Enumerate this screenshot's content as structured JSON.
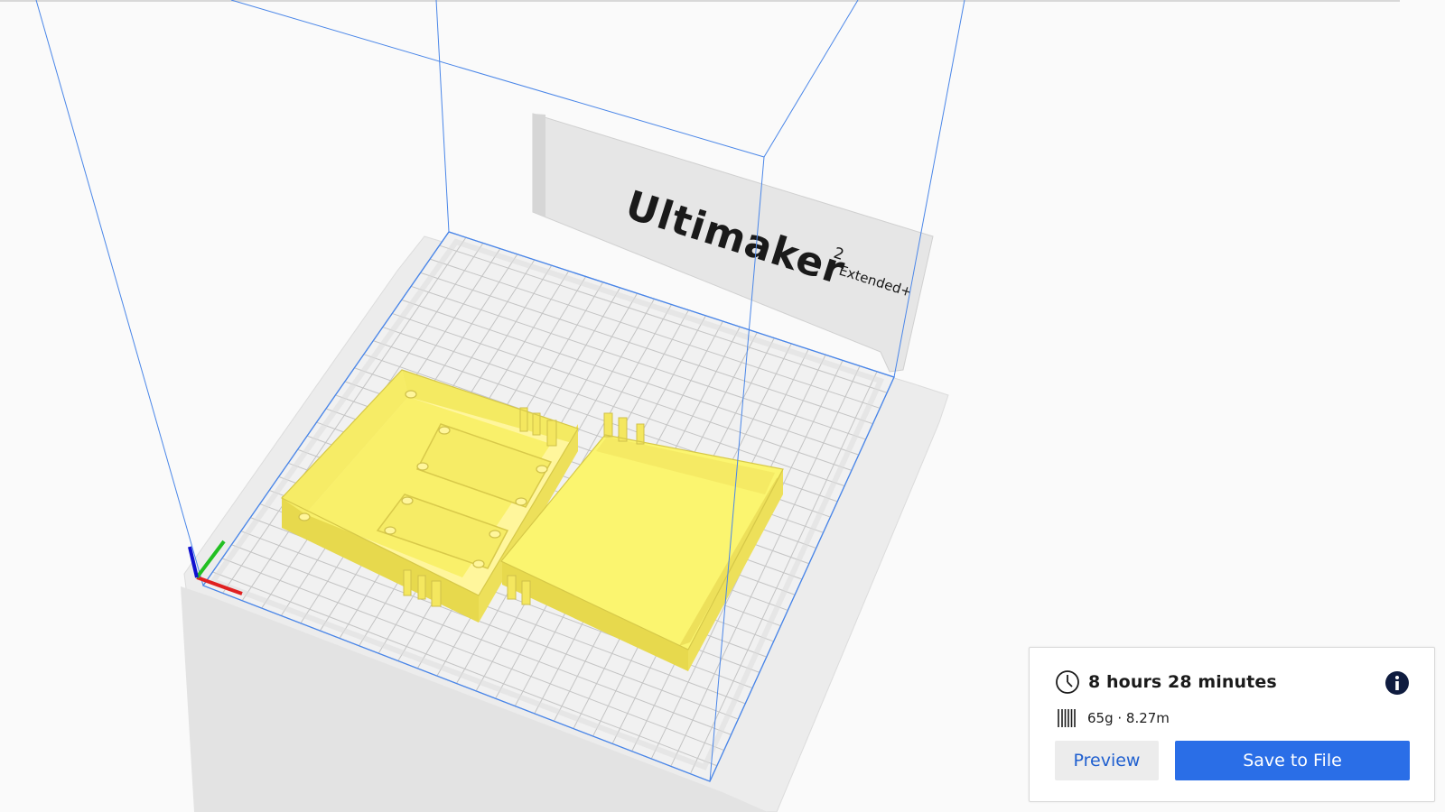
{
  "viewport": {
    "printer_brand": "Ultimaker",
    "printer_superscript": "2",
    "printer_variant": "Extended+",
    "model_color": "#f9f06a",
    "build_volume_line_color": "#4a86e8",
    "axis_colors": {
      "x": "#e02020",
      "y": "#22c022",
      "z": "#1010d0"
    }
  },
  "job": {
    "clock_icon": "clock-icon",
    "print_time": "8 hours 28 minutes",
    "info_icon": "info-icon",
    "filament_icon": "filament-spool-icon",
    "material_estimate": "65g · 8.27m",
    "preview_label": "Preview",
    "save_label": "Save to File",
    "accent_color": "#2a6ee7"
  }
}
